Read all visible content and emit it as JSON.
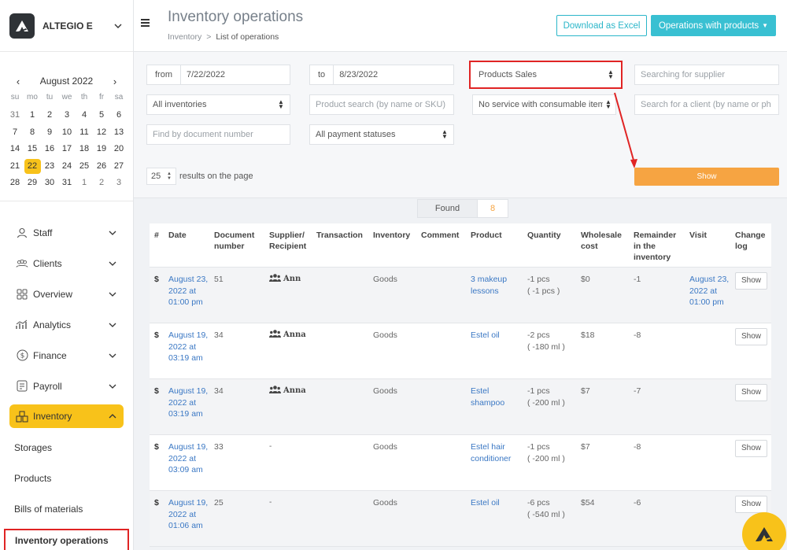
{
  "brand": {
    "name": "ALTEGIO E"
  },
  "calendar": {
    "month_label": "August 2022",
    "prev": "‹",
    "next": "›",
    "dow": [
      "su",
      "mo",
      "tu",
      "we",
      "th",
      "fr",
      "sa"
    ],
    "weeks": [
      [
        "31",
        "1",
        "2",
        "3",
        "4",
        "5",
        "6"
      ],
      [
        "7",
        "8",
        "9",
        "10",
        "11",
        "12",
        "13"
      ],
      [
        "14",
        "15",
        "16",
        "17",
        "18",
        "19",
        "20"
      ],
      [
        "21",
        "22",
        "23",
        "24",
        "25",
        "26",
        "27"
      ],
      [
        "28",
        "29",
        "30",
        "31",
        "1",
        "2",
        "3"
      ]
    ],
    "selected": "22"
  },
  "nav": {
    "items": [
      {
        "label": "Staff",
        "icon": "person-icon"
      },
      {
        "label": "Clients",
        "icon": "clients-icon"
      },
      {
        "label": "Overview",
        "icon": "grid-icon"
      },
      {
        "label": "Analytics",
        "icon": "analytics-icon"
      },
      {
        "label": "Finance",
        "icon": "dollar-circle-icon"
      },
      {
        "label": "Payroll",
        "icon": "payroll-icon"
      },
      {
        "label": "Inventory",
        "icon": "boxes-icon"
      }
    ],
    "sub": [
      "Storages",
      "Products",
      "Bills of materials",
      "Inventory operations"
    ]
  },
  "header": {
    "title": "Inventory operations",
    "breadcrumb": [
      "Inventory",
      "List of operations"
    ],
    "breadcrumb_sep": ">",
    "excel": "Download as Excel",
    "ops": "Operations with products"
  },
  "filters": {
    "from_label": "from",
    "from_value": "7/22/2022",
    "to_label": "to",
    "to_value": "8/23/2022",
    "op_type": "Products Sales",
    "supplier_ph": "Searching for supplier",
    "inventories": "All inventories",
    "product_ph": "Product search (by name or SKU)",
    "consumable": "No service with consumable item",
    "client_ph": "Search for a client (by name or ph",
    "doc_ph": "Find by document number",
    "payment": "All payment statuses",
    "per_page": "25",
    "per_page_label": "results on the page",
    "show": "Show"
  },
  "found": {
    "label": "Found",
    "count": "8"
  },
  "table": {
    "headers": [
      "#",
      "Date",
      "Document number",
      "Supplier/ Recipient",
      "Transaction",
      "Inventory",
      "Comment",
      "Product",
      "Quantity",
      "Wholesale cost",
      "Remainder in the inventory",
      "Visit",
      "Change log"
    ],
    "rows": [
      {
        "mark": "$",
        "date": "August 23, 2022 at 01:00 pm",
        "doc": "51",
        "recipient": "Ann",
        "transaction": "",
        "inventory": "Goods",
        "comment": "",
        "product": "3 makeup lessons",
        "qty1": "-1 pcs",
        "qty2": "( -1 pcs )",
        "cost": "$0",
        "remainder": "-1",
        "visit": "August 23, 2022 at 01:00 pm",
        "log": "Show"
      },
      {
        "mark": "$",
        "date": "August 19, 2022 at 03:19 am",
        "doc": "34",
        "recipient": "Anna",
        "transaction": "",
        "inventory": "Goods",
        "comment": "",
        "product": "Estel oil",
        "qty1": "-2 pcs",
        "qty2": "( -180 ml )",
        "cost": "$18",
        "remainder": "-8",
        "visit": "",
        "log": "Show"
      },
      {
        "mark": "$",
        "date": "August 19, 2022 at 03:19 am",
        "doc": "34",
        "recipient": "Anna",
        "transaction": "",
        "inventory": "Goods",
        "comment": "",
        "product": "Estel shampoo",
        "qty1": "-1 pcs",
        "qty2": "( -200 ml )",
        "cost": "$7",
        "remainder": "-7",
        "visit": "",
        "log": "Show"
      },
      {
        "mark": "$",
        "date": "August 19, 2022 at 03:09 am",
        "doc": "33",
        "recipient": "-",
        "transaction": "",
        "inventory": "Goods",
        "comment": "",
        "product": "Estel hair conditioner",
        "qty1": "-1 pcs",
        "qty2": "( -200 ml )",
        "cost": "$7",
        "remainder": "-8",
        "visit": "",
        "log": "Show"
      },
      {
        "mark": "$",
        "date": "August 19, 2022 at 01:06 am",
        "doc": "25",
        "recipient": "-",
        "transaction": "",
        "inventory": "Goods",
        "comment": "",
        "product": "Estel oil",
        "qty1": "-6 pcs",
        "qty2": "( -540 ml )",
        "cost": "$54",
        "remainder": "-6",
        "visit": "",
        "log": "Show"
      }
    ]
  },
  "colors": {
    "accent": "#f8c21a",
    "teal": "#39c0d2",
    "orange": "#f6a442",
    "highlight": "#e02424",
    "link": "#3b78c4"
  }
}
